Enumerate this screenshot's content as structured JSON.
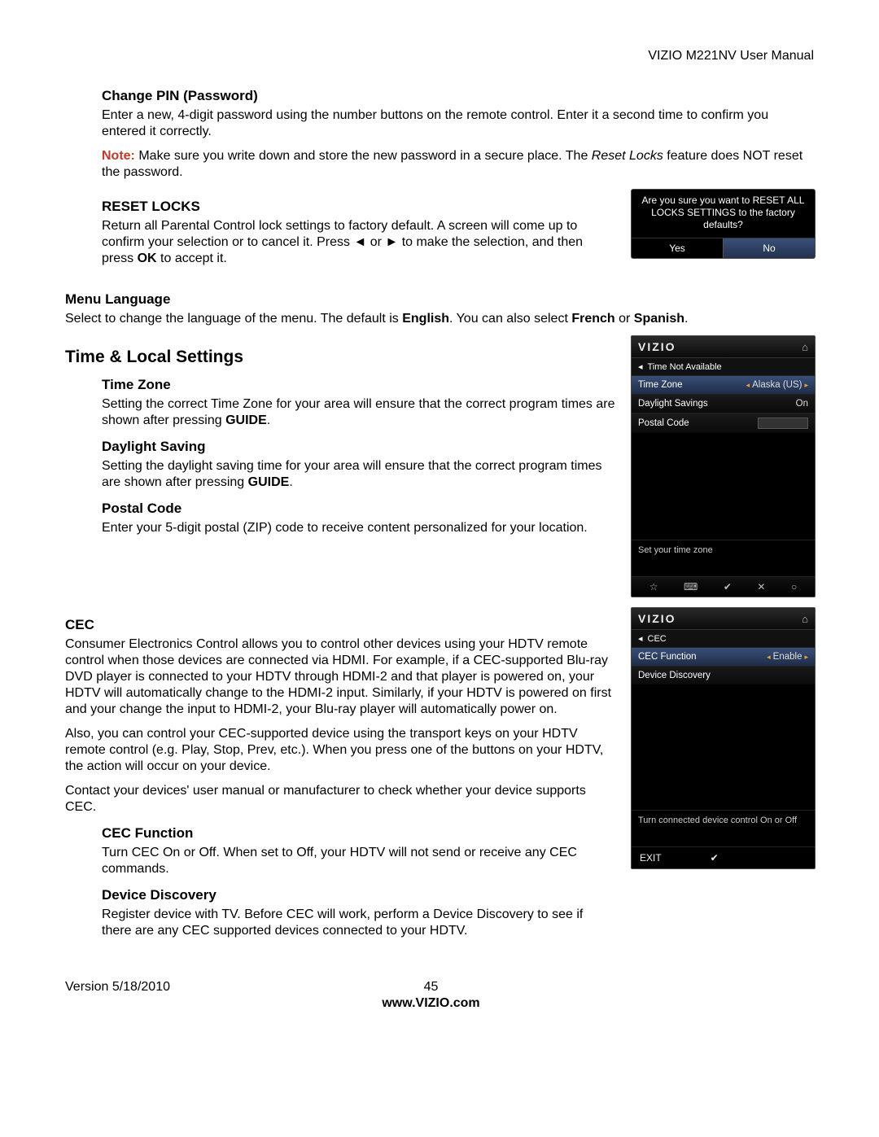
{
  "header": {
    "doc_title": "VIZIO M221NV User Manual"
  },
  "change_pin": {
    "heading": "Change PIN (Password)",
    "body": "Enter a new, 4-digit password using the number buttons on the remote control. Enter it a second time to confirm you entered it correctly.",
    "note_label": "Note:",
    "note_pre": " Make sure you write down and store the new password in a secure place. The ",
    "note_italic": "Reset Locks",
    "note_post": " feature does NOT reset the password."
  },
  "reset_locks": {
    "heading": "RESET LOCKS",
    "body_pre": "Return all Parental Control lock settings to factory default. A screen will come up to confirm your selection or to cancel it. Press ◄ or ► to make the selection, and then press ",
    "body_bold": "OK",
    "body_post": " to accept it.",
    "dialog": {
      "line1": "Are you sure you want to RESET ALL",
      "line2": "LOCKS SETTINGS to the factory",
      "line3": "defaults?",
      "yes": "Yes",
      "no": "No"
    }
  },
  "menu_lang": {
    "heading": "Menu Language",
    "body_pre": "Select to change the language of the menu. The default is ",
    "english": "English",
    "body_mid": ". You can also select ",
    "french": "French",
    "or": " or ",
    "spanish": "Spanish",
    "period": "."
  },
  "time_section": {
    "heading": "Time & Local Settings",
    "tz_h": "Time Zone",
    "tz_pre": "Setting the correct Time Zone for your area will ensure that the correct program times are shown after pressing ",
    "guide": "GUIDE",
    "period": ".",
    "ds_h": "Daylight Saving",
    "ds_pre": "Setting the daylight saving time for your area will ensure that the correct program times are shown after pressing ",
    "pc_h": "Postal Code",
    "pc_body": "Enter your 5-digit postal (ZIP) code to receive content personalized for your location."
  },
  "cec_section": {
    "heading": "CEC",
    "p1": "Consumer Electronics Control allows you to control other devices using your HDTV remote control when those devices are connected via HDMI. For example, if a CEC-supported Blu-ray DVD player is connected to your HDTV through HDMI-2 and that player is powered on, your HDTV will automatically change to the HDMI-2 input. Similarly, if your HDTV is powered on first and your change the input to HDMI-2, your Blu-ray player will automatically power on.",
    "p2": "Also, you can control your CEC-supported device using the transport keys on your HDTV remote control (e.g. Play, Stop, Prev, etc.). When you press one of the buttons on your HDTV, the action will occur on your device.",
    "p3": "Contact your devices' user manual or manufacturer to check whether your device supports CEC.",
    "cf_h": "CEC Function",
    "cf_body": "Turn CEC On or Off. When set to Off, your HDTV will not send or receive any CEC commands.",
    "dd_h": "Device Discovery",
    "dd_body": "Register device with TV. Before CEC will work, perform a Device Discovery to see if there are any CEC supported devices connected to your HDTV."
  },
  "osd_time": {
    "brand": "VIZIO",
    "crumb": "Time Not Available",
    "items": [
      {
        "label": "Time Zone",
        "value": "Alaska (US)",
        "selected": true
      },
      {
        "label": "Daylight Savings",
        "value": "On",
        "selected": false
      },
      {
        "label": "Postal Code",
        "value": "",
        "selected": false,
        "input": true
      }
    ],
    "helper": "Set your time zone"
  },
  "osd_cec": {
    "brand": "VIZIO",
    "crumb": "CEC",
    "items": [
      {
        "label": "CEC Function",
        "value": "Enable",
        "selected": true
      },
      {
        "label": "Device Discovery",
        "value": "",
        "selected": false
      }
    ],
    "helper": "Turn connected device control On or Off",
    "exit": "EXIT"
  },
  "footer": {
    "version": "Version 5/18/2010",
    "page": "45",
    "site": "www.VIZIO.com"
  }
}
